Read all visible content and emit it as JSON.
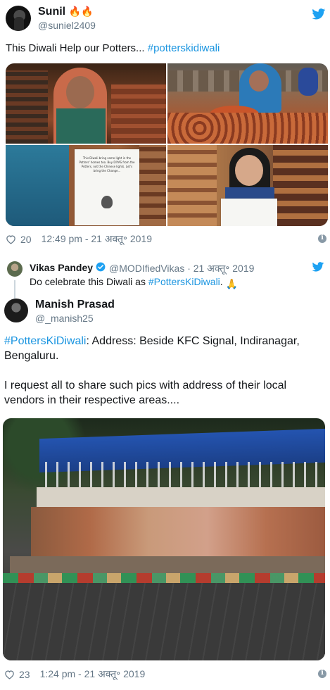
{
  "colors": {
    "twitter_blue": "#1da1f2",
    "link": "#1b95e0",
    "muted": "#657786"
  },
  "tweet1": {
    "name": "Sunil",
    "name_emoji": "🔥🔥",
    "handle": "@suniel2409",
    "text_before": "This Diwali Help our Potters... ",
    "hashtag": "#potterskidiwali",
    "photo_sheet_text": "This Diwali bring some light in the Potters' homes too. Buy DIYAS from the Potters, not the Chinese lights. Let's bring the Change...",
    "likes": "20",
    "timestamp": "12:49 pm - 21 अक्तू॰ 2019"
  },
  "parent": {
    "name": "Vikas Pandey",
    "handle_date": "@MODIfiedVikas · 21 अक्तू॰ 2019",
    "text_before": "Do celebrate this Diwali as ",
    "hashtag": "#PottersKiDiwali",
    "text_after": ". ",
    "emoji": "🙏"
  },
  "tweet2": {
    "name": "Manish Prasad",
    "handle": "@_manish25",
    "hashtag": "#PottersKiDiwali",
    "line1_rest": ": Address: Beside KFC Signal, Indiranagar, Bengaluru.",
    "line2": "I request all to share such pics with address of their local vendors in their respective areas....",
    "likes": "23",
    "timestamp": "1:24 pm - 21 अक्तू॰ 2019"
  },
  "icons": [
    "twitter-bird-icon",
    "heart-icon",
    "info-icon",
    "verified-badge-icon",
    "folded-hands-emoji"
  ]
}
